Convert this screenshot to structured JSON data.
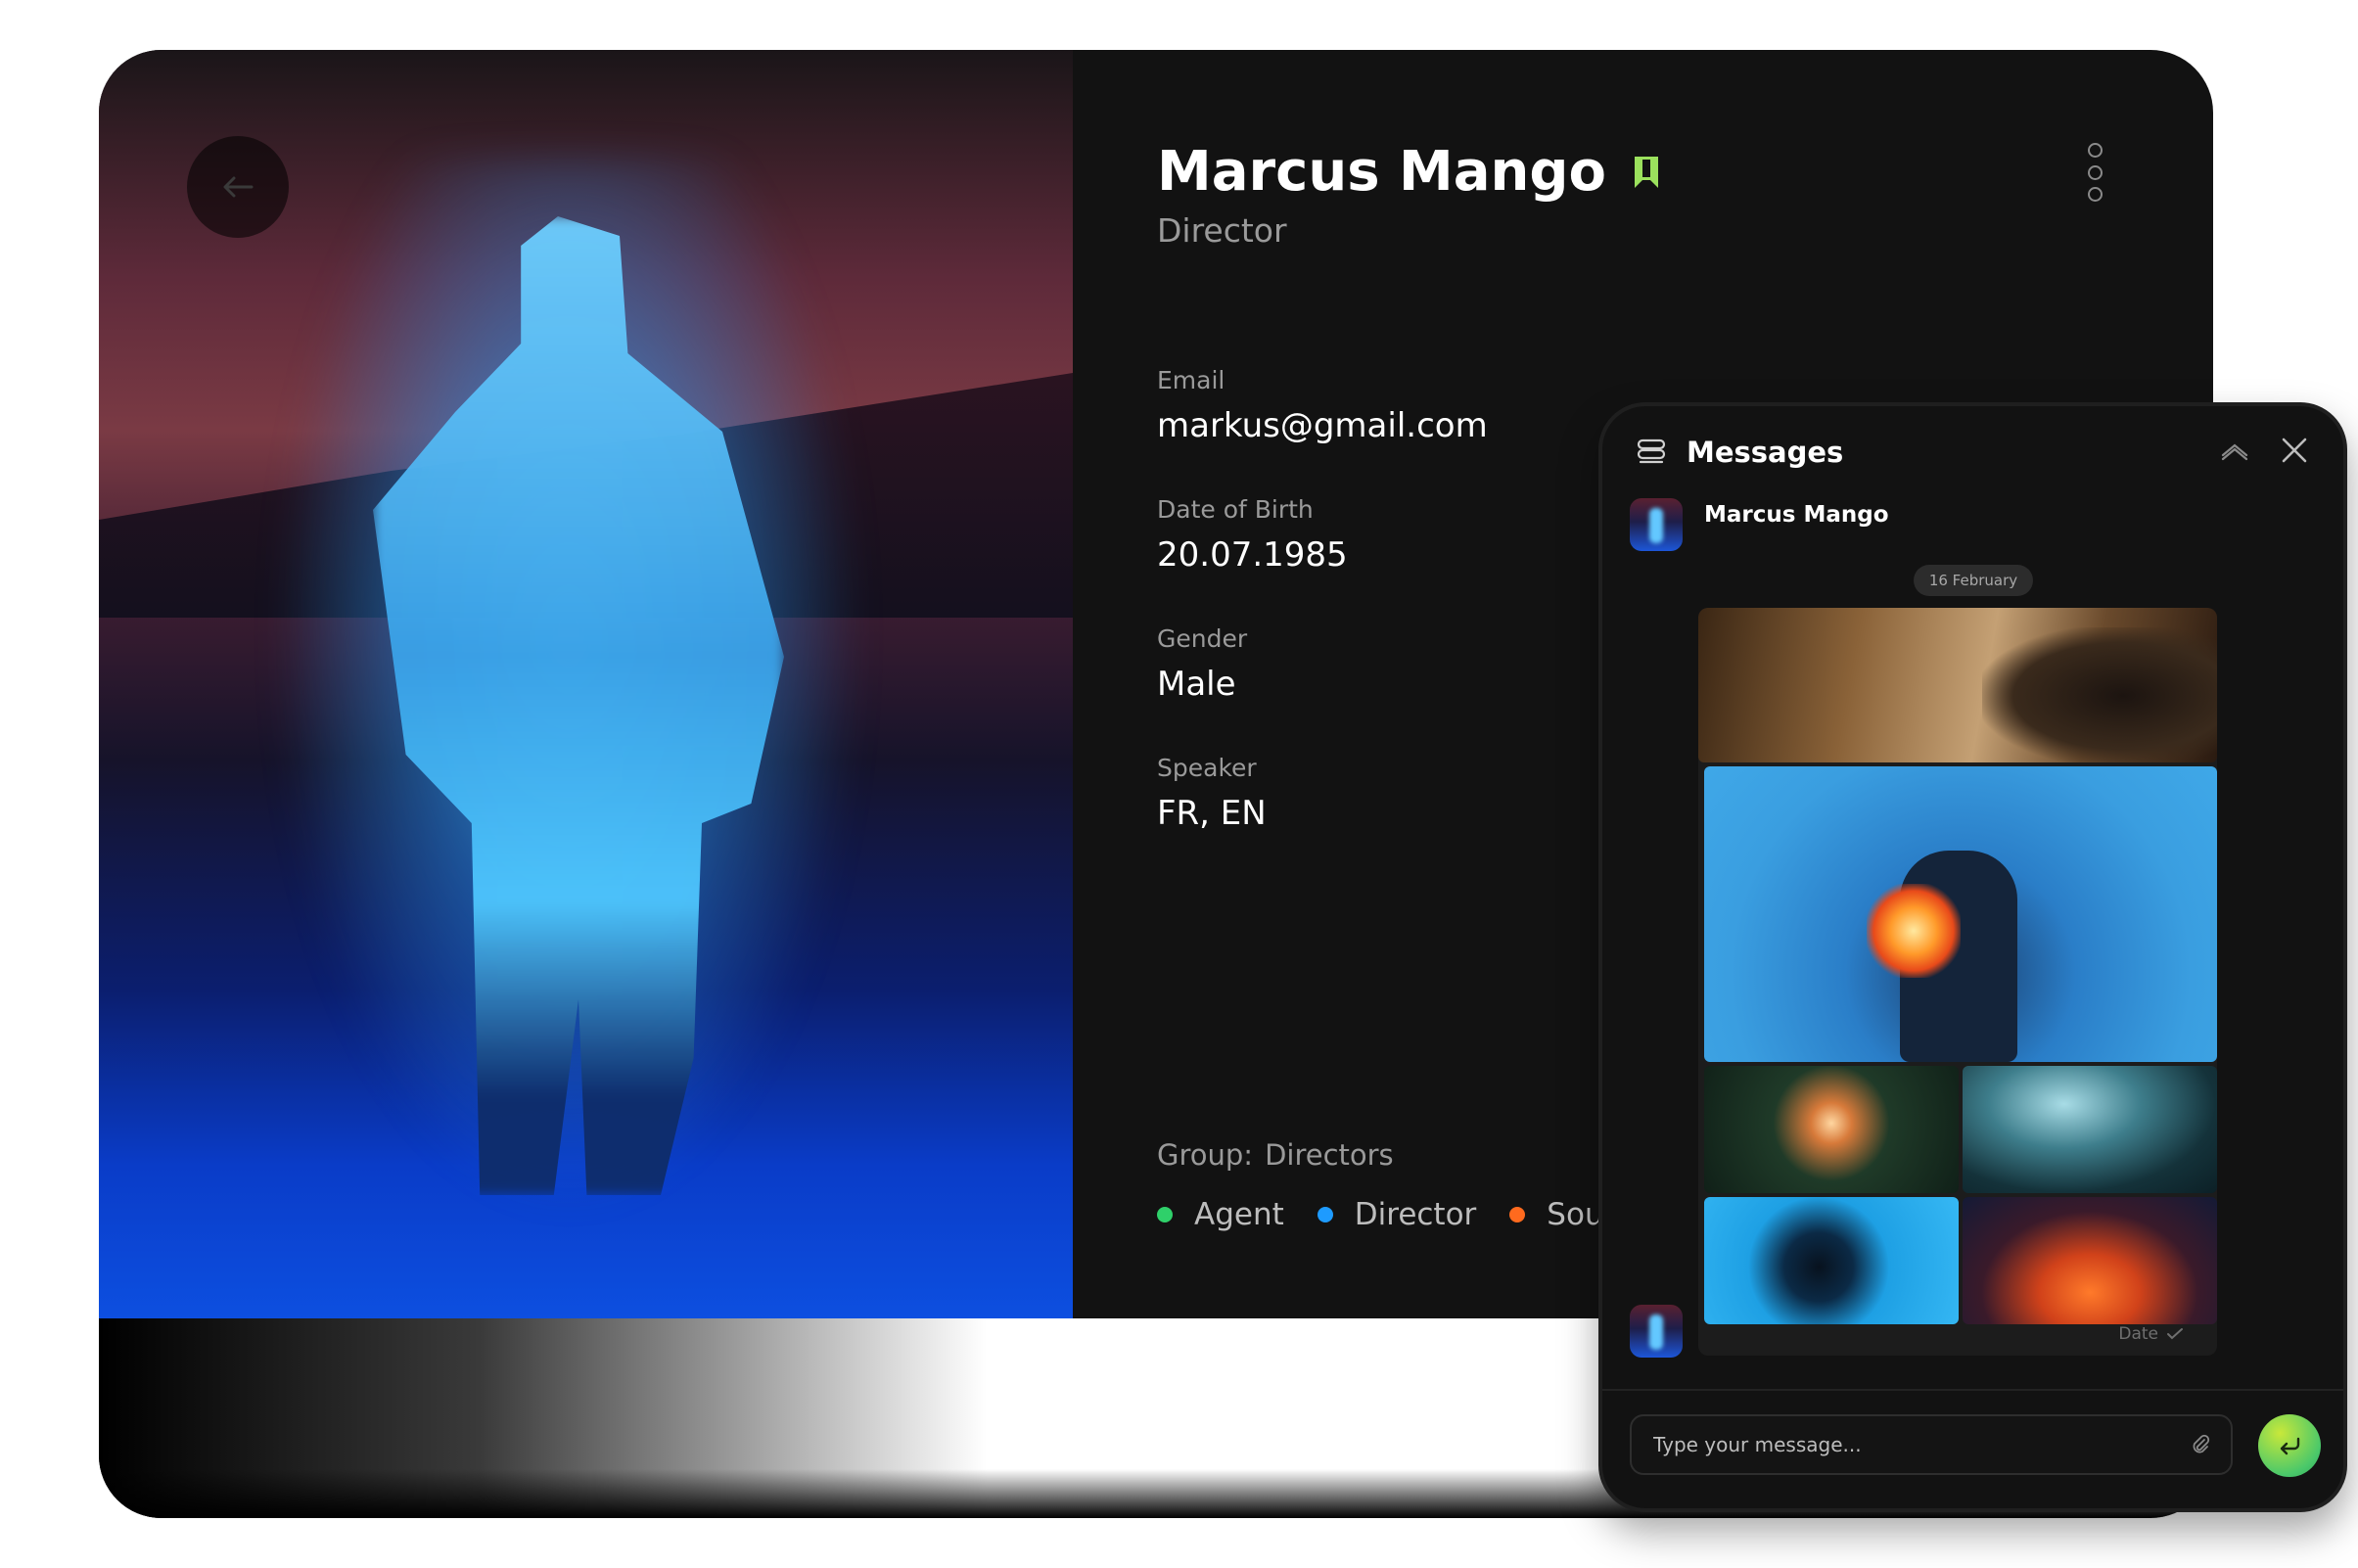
{
  "profile": {
    "name": "Marcus Mango",
    "role": "Director",
    "fields": [
      {
        "label": "Email",
        "value": "markus@gmail.com"
      },
      {
        "label": "Date of Birth",
        "value": "20.07.1985"
      },
      {
        "label": "Gender",
        "value": "Male"
      },
      {
        "label": "Speaker",
        "value": "FR, EN"
      }
    ],
    "group_label": "Group:",
    "group_value": "Directors",
    "tags": [
      {
        "label": "Agent",
        "color": "#2fd06a"
      },
      {
        "label": "Director",
        "color": "#1e9bff"
      },
      {
        "label": "Sou",
        "color": "#ff6a1e"
      }
    ],
    "bookmark_color": "#9be15d"
  },
  "messages": {
    "title": "Messages",
    "contact_name": "Marcus Mango",
    "date_pill": "16 February",
    "album_date": "Date",
    "input_placeholder": "Type your message..."
  },
  "icons": {
    "back": "arrow-left-icon",
    "bookmark": "bookmark-icon",
    "more": "more-vertical-icon",
    "messages": "chat-icon",
    "collapse": "chevron-up-icon",
    "close": "close-icon",
    "attach": "paperclip-icon",
    "send": "enter-icon",
    "read": "check-icon"
  }
}
